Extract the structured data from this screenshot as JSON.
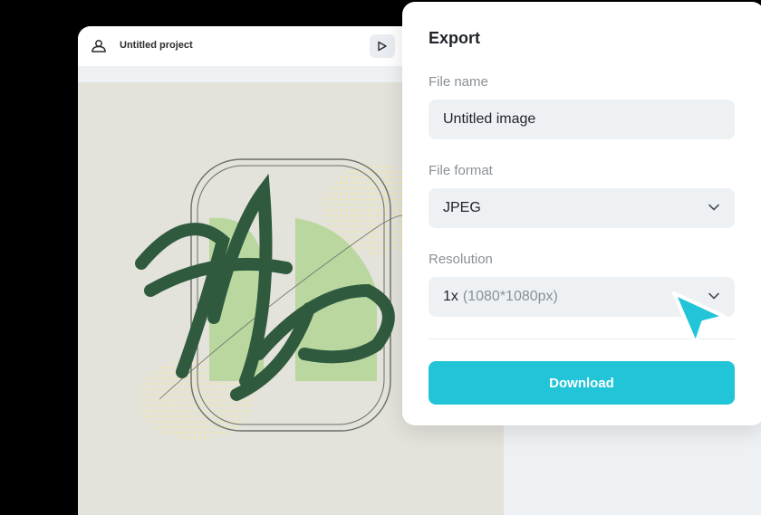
{
  "editor": {
    "project_title": "Untitled project"
  },
  "export": {
    "title": "Export",
    "file_name": {
      "label": "File name",
      "value": "Untitled image"
    },
    "file_format": {
      "label": "File format",
      "value": "JPEG"
    },
    "resolution": {
      "label": "Resolution",
      "value": "1x",
      "detail": "(1080*1080px)"
    },
    "download_label": "Download"
  },
  "colors": {
    "accent": "#22c5d8",
    "background": "#000000",
    "panel": "#ffffff",
    "field": "#eef1f4",
    "artwork_green": "#2f5a3e",
    "artwork_light_green": "#b9d79f"
  },
  "icons": {
    "project": "cloud-user-icon",
    "preview": "play-icon",
    "dropdown": "chevron-down-icon",
    "pointer": "mouse-pointer-icon"
  }
}
